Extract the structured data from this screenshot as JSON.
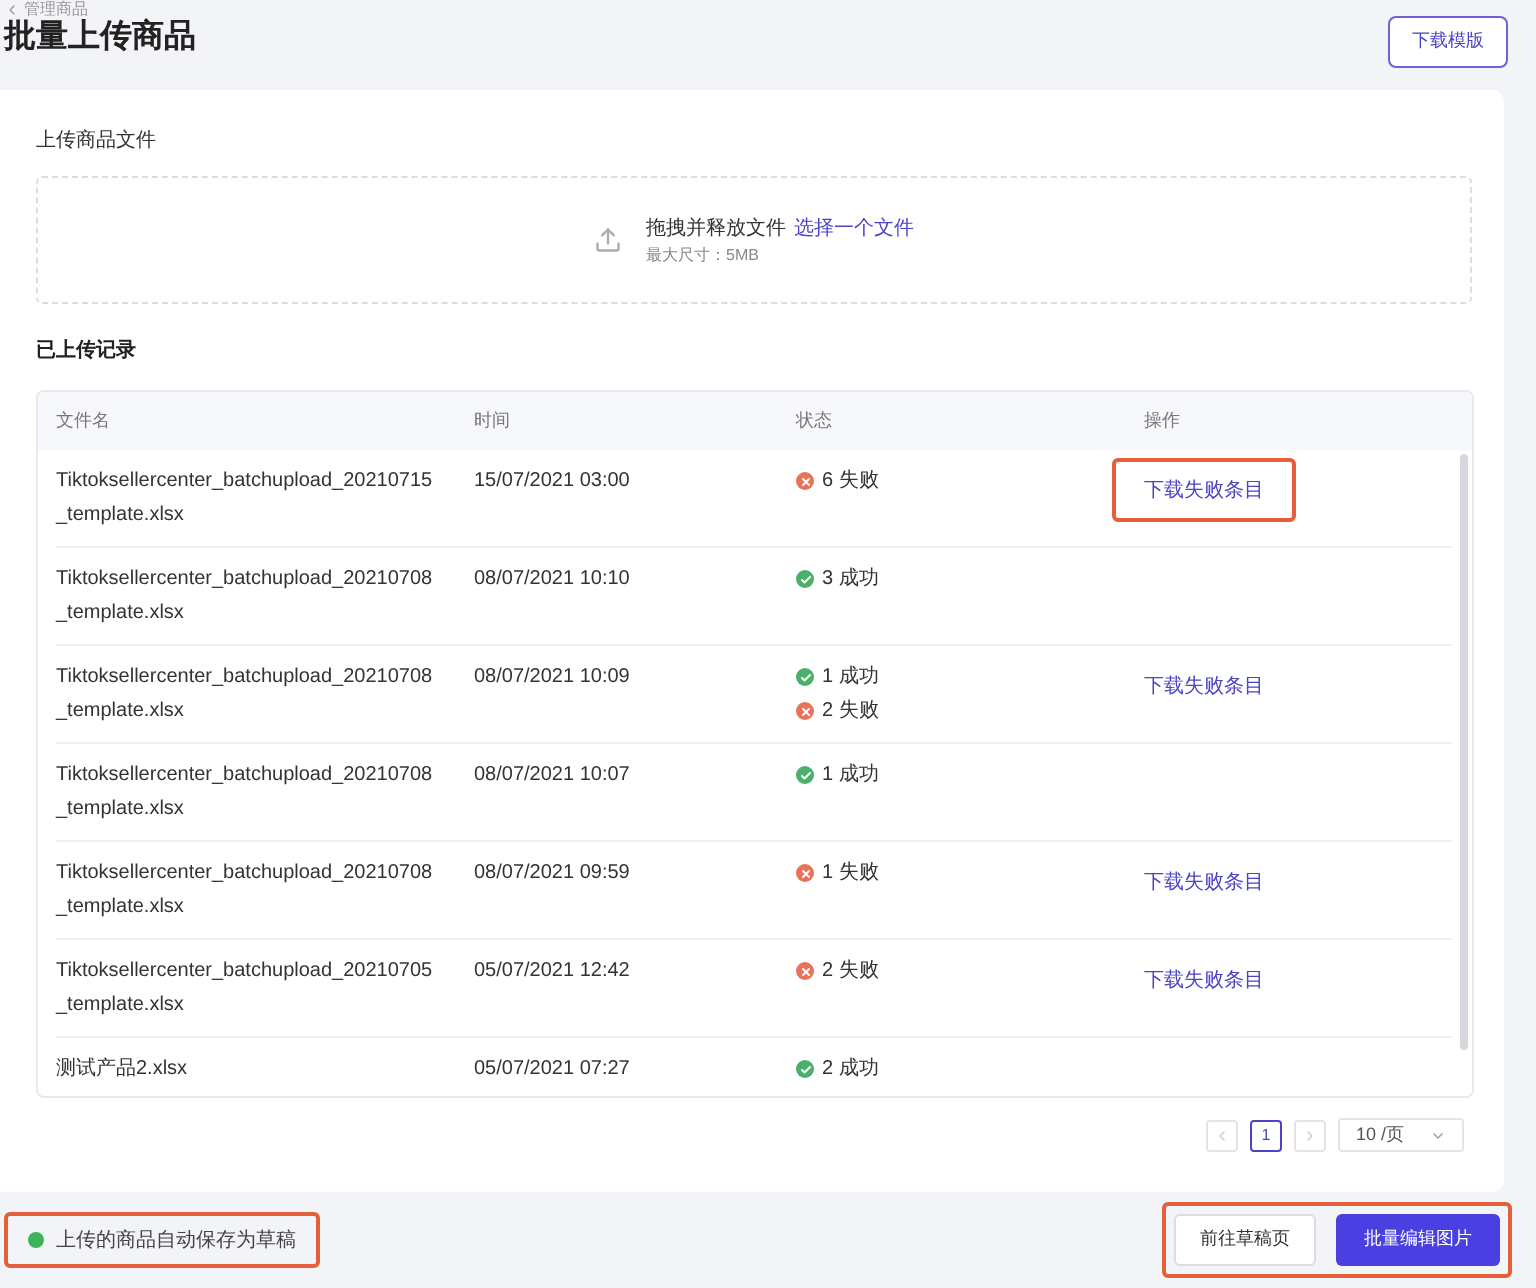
{
  "breadcrumb": {
    "label": "管理商品"
  },
  "title": "批量上传商品",
  "template_button": "下载模版",
  "upload": {
    "label": "上传商品文件",
    "prompt": "拖拽并释放文件",
    "link": "选择一个文件",
    "hint": "最大尺寸：5MB"
  },
  "history": {
    "title": "已上传记录",
    "columns": [
      "文件名",
      "时间",
      "状态",
      "操作"
    ],
    "rows": [
      {
        "file_lines": [
          "Tiktoksellercenter_batchupload_20210715",
          "_template.xlsx"
        ],
        "time": "15/07/2021 03:00",
        "statuses": [
          {
            "kind": "fail",
            "text": "6 失败"
          }
        ],
        "action": {
          "label": "下载失败条目",
          "highlighted": true
        }
      },
      {
        "file_lines": [
          "Tiktoksellercenter_batchupload_20210708",
          "_template.xlsx"
        ],
        "time": "08/07/2021 10:10",
        "statuses": [
          {
            "kind": "success",
            "text": "3 成功"
          }
        ]
      },
      {
        "file_lines": [
          "Tiktoksellercenter_batchupload_20210708",
          "_template.xlsx"
        ],
        "time": "08/07/2021 10:09",
        "statuses": [
          {
            "kind": "success",
            "text": "1 成功"
          },
          {
            "kind": "fail",
            "text": "2 失败"
          }
        ],
        "action": {
          "label": "下载失败条目"
        }
      },
      {
        "file_lines": [
          "Tiktoksellercenter_batchupload_20210708",
          "_template.xlsx"
        ],
        "time": "08/07/2021 10:07",
        "statuses": [
          {
            "kind": "success",
            "text": "1 成功"
          }
        ]
      },
      {
        "file_lines": [
          "Tiktoksellercenter_batchupload_20210708",
          "_template.xlsx"
        ],
        "time": "08/07/2021 09:59",
        "statuses": [
          {
            "kind": "fail",
            "text": "1 失败"
          }
        ],
        "action": {
          "label": "下载失败条目"
        }
      },
      {
        "file_lines": [
          "Tiktoksellercenter_batchupload_20210705",
          "_template.xlsx"
        ],
        "time": "05/07/2021 12:42",
        "statuses": [
          {
            "kind": "fail",
            "text": "2 失败"
          }
        ],
        "action": {
          "label": "下载失败条目"
        }
      },
      {
        "file_lines": [
          "测试产品2.xlsx"
        ],
        "time": "05/07/2021 07:27",
        "statuses": [
          {
            "kind": "success",
            "text": "2 成功"
          }
        ]
      }
    ]
  },
  "pagination": {
    "pages": [
      {
        "label": "1",
        "selected": true
      }
    ],
    "page_size": "10 /页"
  },
  "footer": {
    "draft_note": {
      "text": "上传的商品自动保存为草稿",
      "checked": true,
      "highlighted": true
    },
    "buttons_highlighted": true,
    "buttons": [
      {
        "kind": "secondary",
        "label": "前往草稿页"
      },
      {
        "kind": "primary",
        "label": "批量编辑图片"
      }
    ]
  }
}
